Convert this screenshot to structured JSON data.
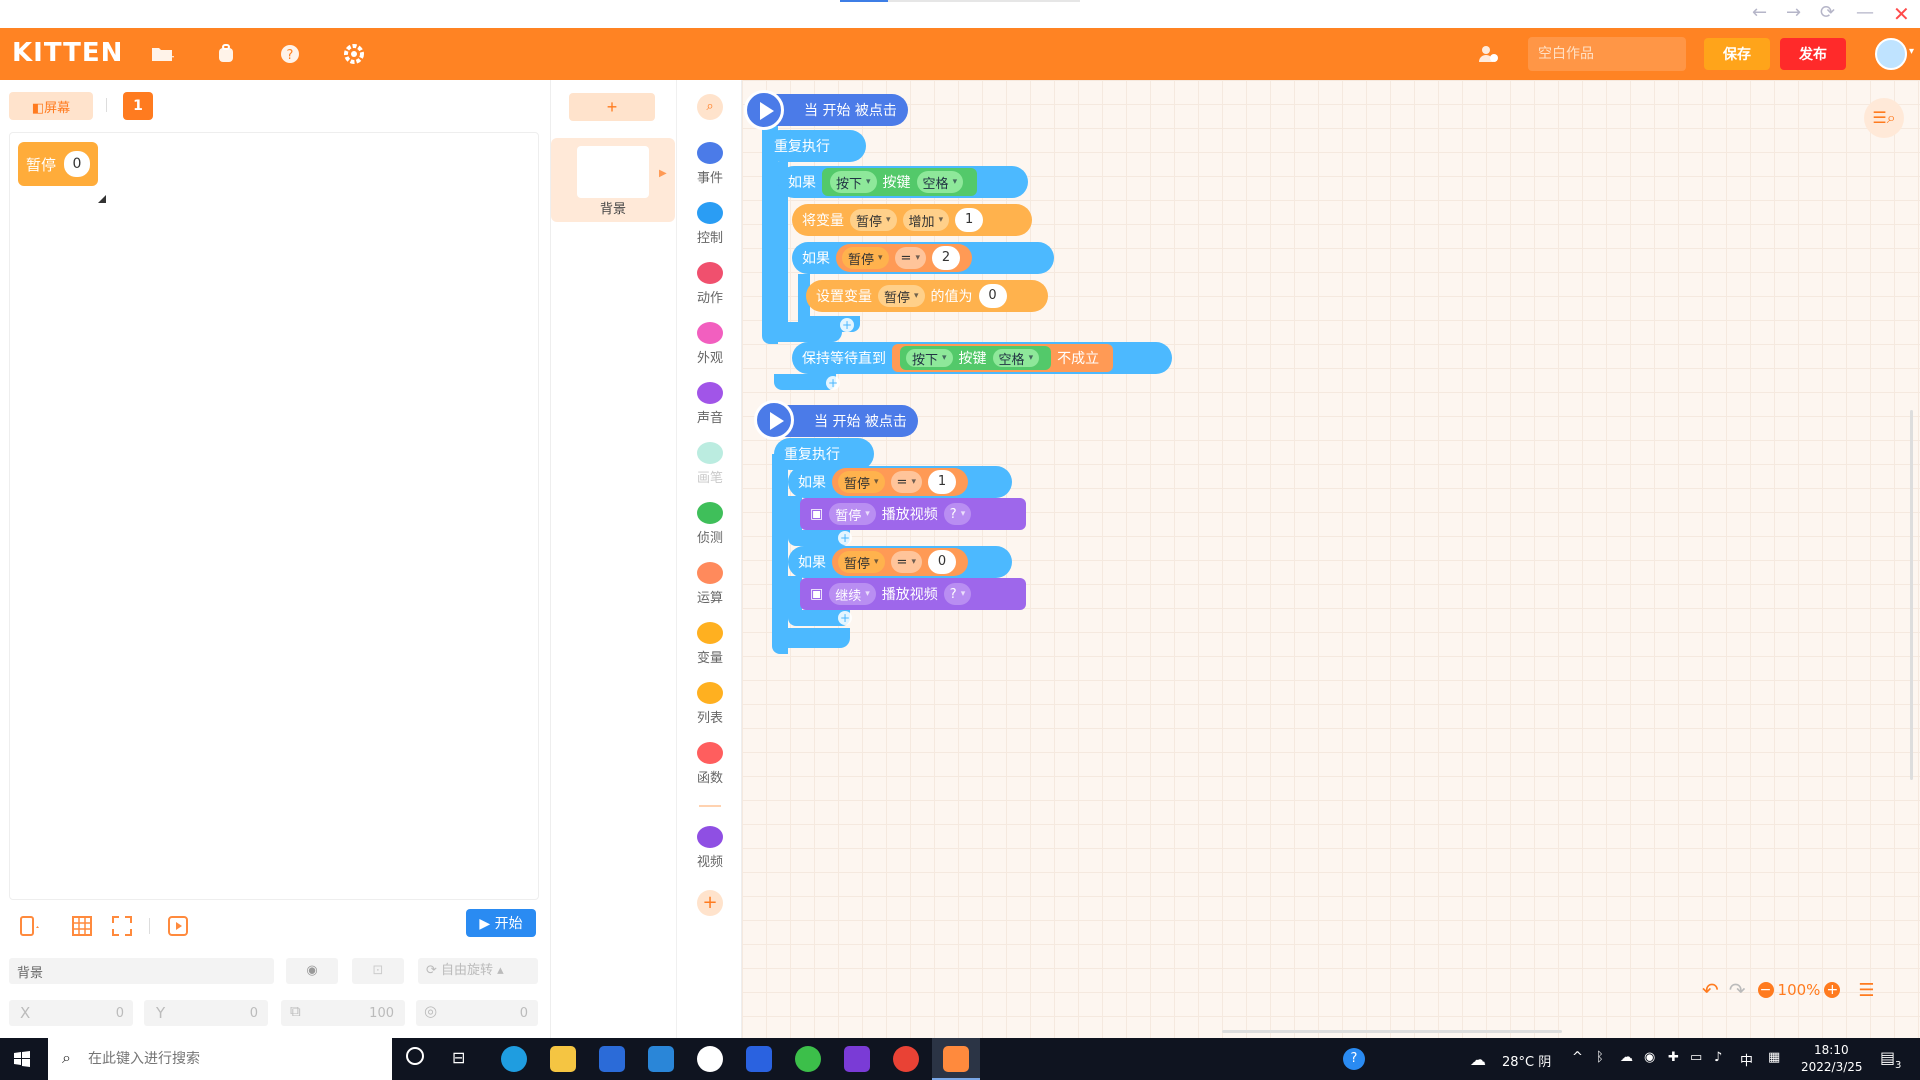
{
  "window": {
    "controls": {
      "back": "←",
      "forward": "→",
      "refresh": "⟳",
      "minimize": "—",
      "close": "✕"
    }
  },
  "header": {
    "logo": "KITTEN",
    "project_placeholder": "空白作品",
    "save_label": "保存",
    "publish_label": "发布"
  },
  "stage": {
    "screen_button": "◧屏幕",
    "screen_number": "1",
    "monitor": {
      "name": "暂停",
      "value": "0"
    },
    "start_label": "▶ 开始"
  },
  "props": {
    "sprite_name": "背景",
    "rotation_mode": "自由旋转",
    "x_label": "X",
    "x_value": "0",
    "y_label": "Y",
    "y_value": "0",
    "size_value": "100",
    "dir_value": "0"
  },
  "sprites": {
    "add_label": "+",
    "background_label": "背景"
  },
  "categories": [
    {
      "label": "事件",
      "color": "#4b7be8"
    },
    {
      "label": "控制",
      "color": "#2a9df4"
    },
    {
      "label": "动作",
      "color": "#f0506e"
    },
    {
      "label": "外观",
      "color": "#f25fbf"
    },
    {
      "label": "声音",
      "color": "#a155e8"
    },
    {
      "label": "画笔",
      "color": "#3ec9a7"
    },
    {
      "label": "侦测",
      "color": "#3fbf5a"
    },
    {
      "label": "运算",
      "color": "#ff8a5c"
    },
    {
      "label": "变量",
      "color": "#ffb020"
    },
    {
      "label": "列表",
      "color": "#ffb020"
    },
    {
      "label": "函数",
      "color": "#ff5e5e"
    },
    {
      "label": "视频",
      "color": "#8f4fe3"
    }
  ],
  "script1": {
    "hat": "当 开始 被点击",
    "repeat": "重复执行",
    "if1": "如果",
    "press": "按下",
    "key": "按键",
    "space": "空格",
    "change_var": "将变量",
    "var": "暂停",
    "increase": "增加",
    "inc_value": "1",
    "if2": "如果",
    "eq": "=",
    "cmp_value": "2",
    "set_var": "设置变量",
    "set_to": "的值为",
    "set_value": "0",
    "wait_until": "保持等待直到",
    "not_true": "不成立"
  },
  "script2": {
    "hat": "当 开始 被点击",
    "repeat": "重复执行",
    "if1": "如果",
    "var": "暂停",
    "eq": "=",
    "cmp1": "1",
    "pause_opt": "暂停",
    "play_video": "播放视频",
    "q": "?",
    "if2": "如果",
    "cmp2": "0",
    "resume_opt": "继续"
  },
  "workspace": {
    "zoom": "100%"
  },
  "taskbar": {
    "search_placeholder": "在此键入进行搜索",
    "weather": "28°C 阴",
    "ime": "中",
    "time": "18:10",
    "date": "2022/3/25",
    "notif_count": "3"
  }
}
